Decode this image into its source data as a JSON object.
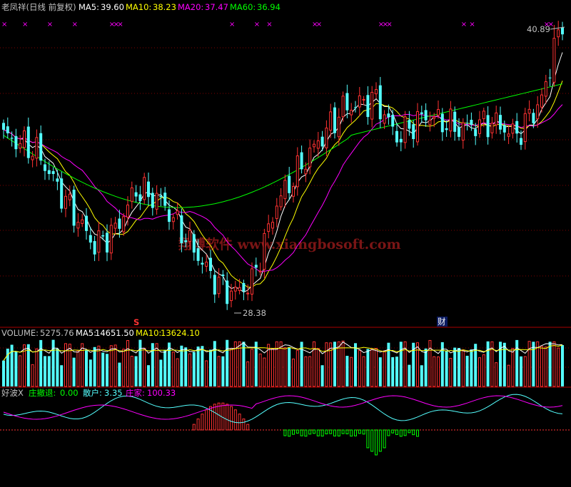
{
  "header": {
    "title": "老凤祥(日线 前复权)",
    "ma5_label": "MA5:",
    "ma5_value": "39.60",
    "ma10_label": "MA10:",
    "ma10_value": "38.23",
    "ma20_label": "MA20:",
    "ma20_value": "37.47",
    "ma60_label": "MA60:",
    "ma60_value": "36.94"
  },
  "price_panel": {
    "high_label": "40.89",
    "low_label": "28.38",
    "watermark": "翔博软件 www.xiangbosoft.com",
    "s_marker": "S",
    "cai_marker": "财",
    "top_marker": "×"
  },
  "volume_panel": {
    "label": "VOLUME:",
    "value": "5275.76",
    "ma5_label": "MA5:",
    "ma5_value": "14651.50",
    "ma10_label": "MA10:",
    "ma10_value": "13624.10"
  },
  "indicator_panel": {
    "name": "好波X",
    "s1_label": "庄撤退:",
    "s1_value": "0.00",
    "s2_label": "散户:",
    "s2_value": "3.35",
    "s3_label": "庄家:",
    "s3_value": "100.33"
  },
  "colors": {
    "up": "#ff3232",
    "down": "#54ffff",
    "ma5": "#ffffff",
    "ma10": "#ffff00",
    "ma20": "#ff00ff",
    "ma60": "#00ff00",
    "grid": "#800000",
    "title": "#c0c0c0",
    "s1": "#00ff00",
    "s2": "#54ffff",
    "s3": "#ff00ff",
    "marker": "#ff00ff"
  },
  "chart_data": {
    "type": "candlestick",
    "price_range": [
      28.38,
      40.89
    ],
    "low_index": 55,
    "high_index": 133,
    "marker_top_indices": [
      0,
      5,
      11,
      17,
      26,
      27,
      28,
      55,
      61,
      64,
      75,
      76,
      91,
      92,
      93,
      111,
      113,
      131,
      132
    ],
    "s_marker_index": 32,
    "cai_marker_index": 103,
    "grid_hlines": true
  }
}
